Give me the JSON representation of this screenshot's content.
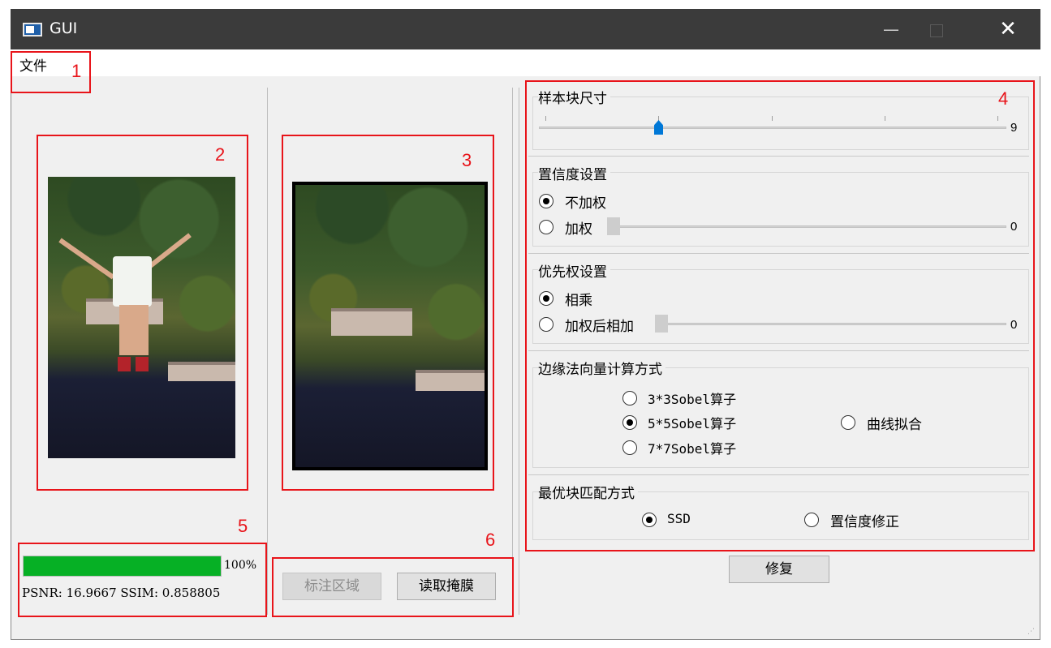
{
  "window": {
    "title": "GUI",
    "minimize": "—",
    "maximize": "",
    "close": "✕"
  },
  "menu": {
    "file": "文件"
  },
  "annotations": [
    "1",
    "2",
    "3",
    "4",
    "5",
    "6"
  ],
  "progress": {
    "value": 100,
    "label": "100%"
  },
  "metrics": {
    "text": "PSNR: 16.9667 SSIM: 0.858805"
  },
  "buttons": {
    "mark_region": "标注区域",
    "read_mask": "读取掩膜",
    "repair": "修复"
  },
  "patch_size": {
    "title": "样本块尺寸",
    "value": "9",
    "slider_fraction": 0.26
  },
  "confidence": {
    "title": "置信度设置",
    "opt_unweighted": "不加权",
    "opt_weighted": "加权",
    "weighted_value": "0"
  },
  "priority": {
    "title": "优先权设置",
    "opt_multiply": "相乘",
    "opt_weighted_sum": "加权后相加",
    "weighted_sum_value": "0"
  },
  "edge_normal": {
    "title": "边缘法向量计算方式",
    "opt_3x3": "3*3Sobel算子",
    "opt_5x5": "5*5Sobel算子",
    "opt_7x7": "7*7Sobel算子",
    "opt_curve": "曲线拟合"
  },
  "best_match": {
    "title": "最优块匹配方式",
    "opt_ssd": "SSD",
    "opt_conf_corr": "置信度修正"
  },
  "colors": {
    "annotation_red": "#e8141a",
    "progress_green": "#06b025",
    "slider_blue": "#0078d7",
    "titlebar": "#3b3b3b"
  },
  "icons": {
    "app": "app-window-icon",
    "min": "minimize-icon",
    "max": "maximize-icon",
    "close": "close-icon"
  }
}
